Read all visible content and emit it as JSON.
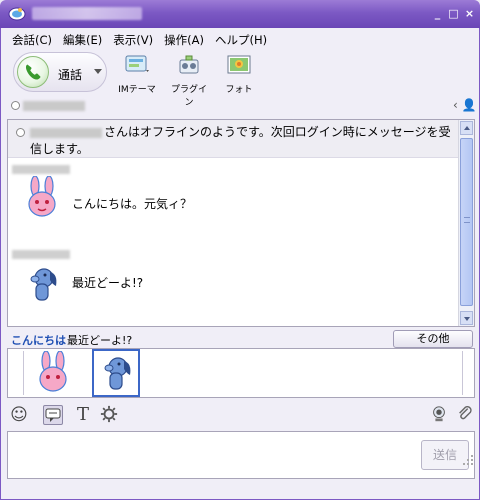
{
  "title_bar": {
    "icon": "messenger-logo-icon",
    "min": "_",
    "max": "□",
    "close": "×"
  },
  "menu": [
    {
      "label": "会話(C)"
    },
    {
      "label": "編集(E)"
    },
    {
      "label": "表示(V)"
    },
    {
      "label": "操作(A)"
    },
    {
      "label": "ヘルプ(H)"
    }
  ],
  "toolbar": {
    "call_label": "通話",
    "im_theme_label": "IMテーマ",
    "plugin_label": "プラグイン",
    "photo_label": "フォト"
  },
  "contact": {
    "status": "offline",
    "nav_icons": "‹ 👤"
  },
  "chat": {
    "notice_text": "さんはオフラインのようです。次回ログイン時にメッセージを受信します。",
    "messages": [
      {
        "text": "こんにちは。元気ィ？",
        "avatar": "pink-rabbit-icon"
      },
      {
        "text": "最近どーよ!?",
        "avatar": "blue-dog-icon"
      }
    ]
  },
  "sticker_bar": {
    "label": "こんにちは",
    "current": "最近どーよ!?",
    "other_button": "その他"
  },
  "format_toolbar": {
    "emoji": "☺",
    "text_tool": "T"
  },
  "input": {
    "send_button": "送信"
  },
  "colors": {
    "title_bar": "#7C59C4",
    "accent_blue": "#3c67c7",
    "sticker_label": "#1f4fb3"
  }
}
